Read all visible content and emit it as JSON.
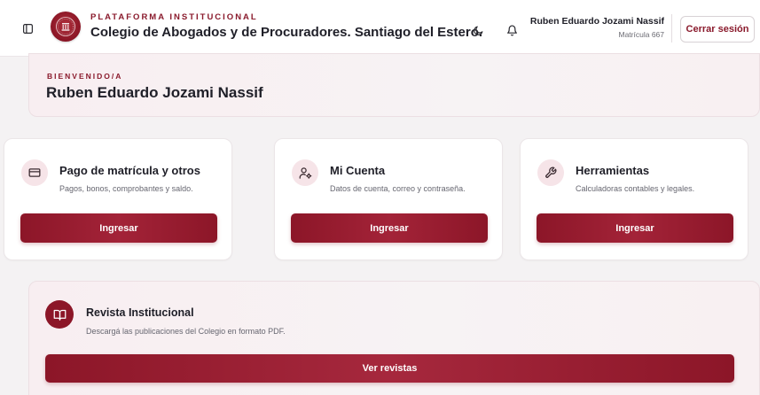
{
  "header": {
    "kicker": "PLATAFORMA INSTITUCIONAL",
    "title": "Colegio de Abogados y de Procuradores. Santiago del Estero.",
    "user_name": "Ruben Eduardo Jozami Nassif",
    "user_sub": "Matrícula 667",
    "logout_label": "Cerrar sesión",
    "icons": [
      "sidebar-toggle-icon",
      "institution-logo",
      "moon-icon",
      "bell-icon"
    ]
  },
  "welcome": {
    "kicker": "BIENVENIDO/A",
    "name": "Ruben Eduardo Jozami Nassif"
  },
  "cards": [
    {
      "icon": "credit-card-icon",
      "title": "Pago de matrícula y otros",
      "desc": "Pagos, bonos, comprobantes y saldo.",
      "button": "Ingresar"
    },
    {
      "icon": "user-cog-icon",
      "title": "Mi Cuenta",
      "desc": "Datos de cuenta, correo y contraseña.",
      "button": "Ingresar"
    },
    {
      "icon": "wrench-icon",
      "title": "Herramientas",
      "desc": "Calculadoras contables y legales.",
      "button": "Ingresar"
    }
  ],
  "revista": {
    "icon": "book-open-icon",
    "title": "Revista Institucional",
    "desc": "Descargá las publicaciones del Colegio en formato PDF.",
    "button": "Ver revistas"
  },
  "colors": {
    "brand": "#8c1628",
    "background": "#f4f2f3",
    "card_icon_bg": "#f6e4e8"
  }
}
